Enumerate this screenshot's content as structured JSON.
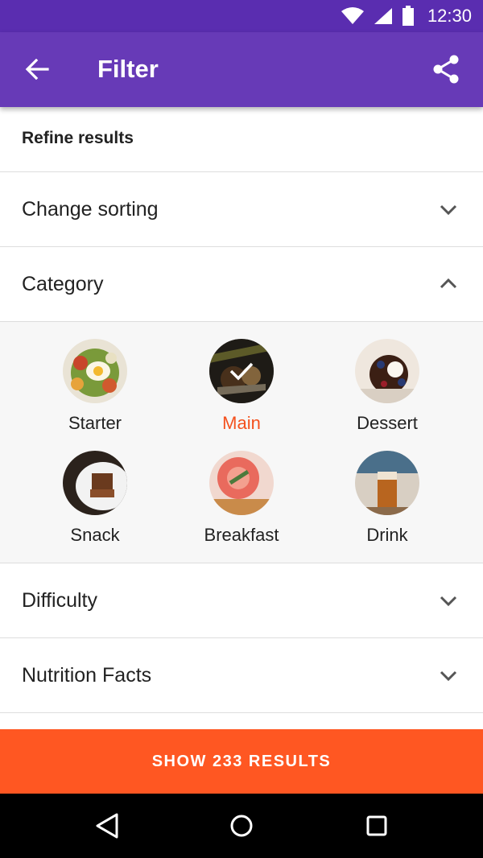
{
  "status_bar": {
    "time": "12:30"
  },
  "app_bar": {
    "title": "Filter",
    "back_icon": "arrow-left-icon",
    "share_icon": "share-icon",
    "color": "#673ab7"
  },
  "refine": {
    "title": "Refine results"
  },
  "sections": {
    "sorting": {
      "label": "Change sorting",
      "expanded": false
    },
    "category": {
      "label": "Category",
      "expanded": true
    },
    "difficulty": {
      "label": "Difficulty",
      "expanded": false
    },
    "nutrition": {
      "label": "Nutrition Facts",
      "expanded": false
    }
  },
  "categories": [
    {
      "label": "Starter",
      "selected": false
    },
    {
      "label": "Main",
      "selected": true
    },
    {
      "label": "Dessert",
      "selected": false
    },
    {
      "label": "Snack",
      "selected": false
    },
    {
      "label": "Breakfast",
      "selected": false
    },
    {
      "label": "Drink",
      "selected": false
    }
  ],
  "footer": {
    "button_label": "SHOW 233 RESULTS",
    "color": "#ff5722"
  },
  "accent_selected": "#f4511e"
}
